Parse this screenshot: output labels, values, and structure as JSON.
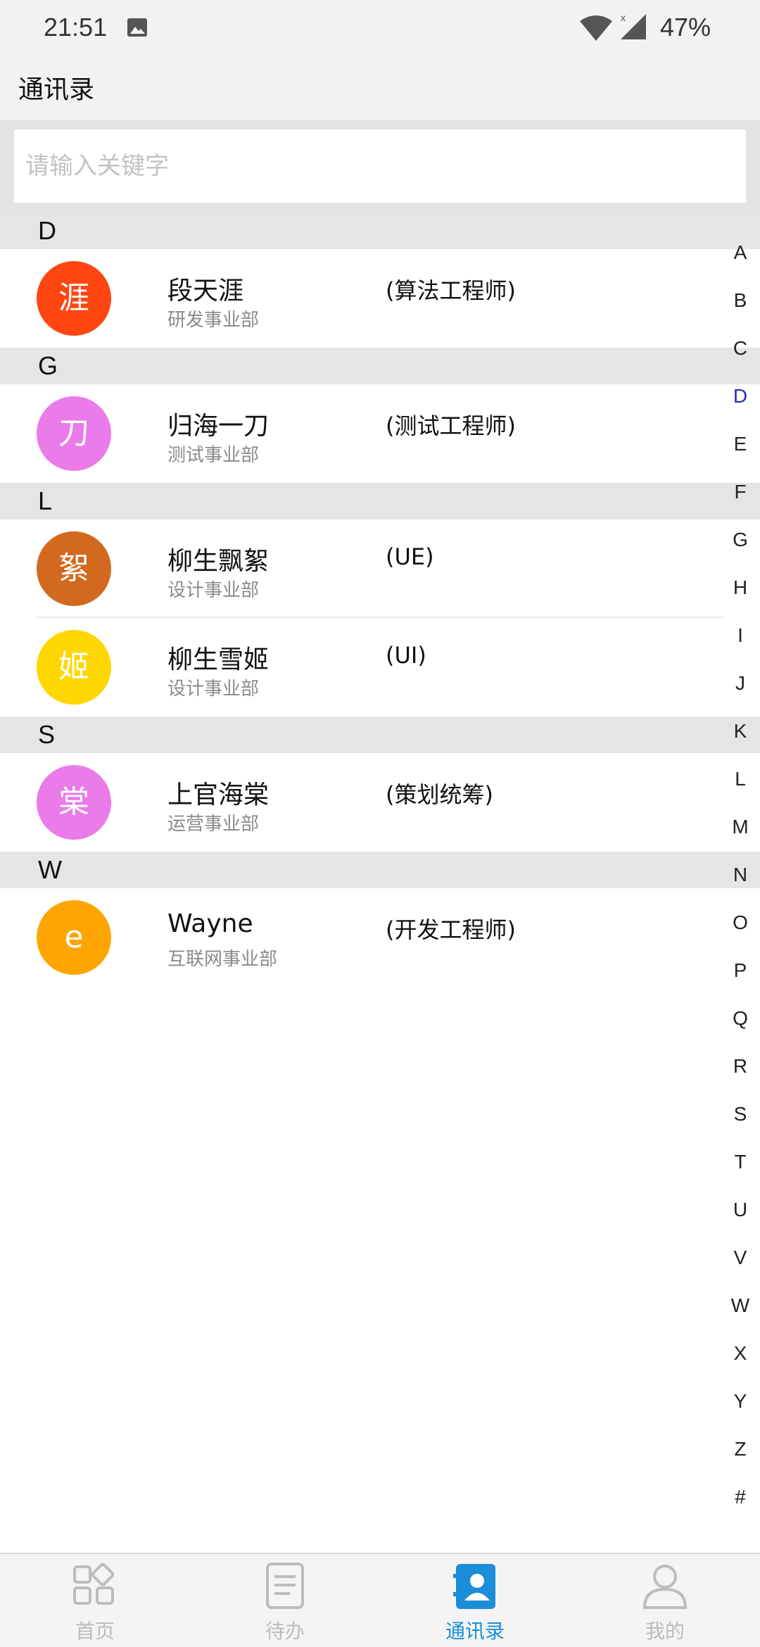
{
  "status": {
    "time": "21:51",
    "battery": "47%"
  },
  "header": {
    "title": "通讯录"
  },
  "search": {
    "placeholder": "请输入关键字",
    "value": ""
  },
  "sections": [
    {
      "letter": "D",
      "contacts": [
        {
          "avatar_char": "涯",
          "avatar_color": "#ff4511",
          "name": "段天涯",
          "dept": "研发事业部",
          "role": "(算法工程师)"
        }
      ]
    },
    {
      "letter": "G",
      "contacts": [
        {
          "avatar_char": "刀",
          "avatar_color": "#ea7be8",
          "name": "归海一刀",
          "dept": "测试事业部",
          "role": "(测试工程师)"
        }
      ]
    },
    {
      "letter": "L",
      "contacts": [
        {
          "avatar_char": "絮",
          "avatar_color": "#d2691e",
          "name": "柳生飘絮",
          "dept": "设计事业部",
          "role": "(UE)"
        },
        {
          "avatar_char": "姬",
          "avatar_color": "#ffd700",
          "name": "柳生雪姬",
          "dept": "设计事业部",
          "role": "(UI)"
        }
      ]
    },
    {
      "letter": "S",
      "contacts": [
        {
          "avatar_char": "棠",
          "avatar_color": "#ea7be8",
          "name": "上官海棠",
          "dept": "运营事业部",
          "role": "(策划统筹)"
        }
      ]
    },
    {
      "letter": "W",
      "contacts": [
        {
          "avatar_char": "e",
          "avatar_color": "#ffa500",
          "name": "Wayne",
          "dept": "互联网事业部",
          "role": "(开发工程师)"
        }
      ]
    }
  ],
  "alphabet": [
    "A",
    "B",
    "C",
    "D",
    "E",
    "F",
    "G",
    "H",
    "I",
    "J",
    "K",
    "L",
    "M",
    "N",
    "O",
    "P",
    "Q",
    "R",
    "S",
    "T",
    "U",
    "V",
    "W",
    "X",
    "Y",
    "Z",
    "#"
  ],
  "alphabet_active": "D",
  "tabs": [
    {
      "label": "首页",
      "icon": "home-grid-icon"
    },
    {
      "label": "待办",
      "icon": "todo-document-icon"
    },
    {
      "label": "通讯录",
      "icon": "contacts-book-icon",
      "active": true
    },
    {
      "label": "我的",
      "icon": "profile-person-icon"
    }
  ],
  "colors": {
    "accent": "#1a8ed8",
    "section_bg": "#e5e5e5",
    "inactive_tab": "#bcbcbc"
  }
}
